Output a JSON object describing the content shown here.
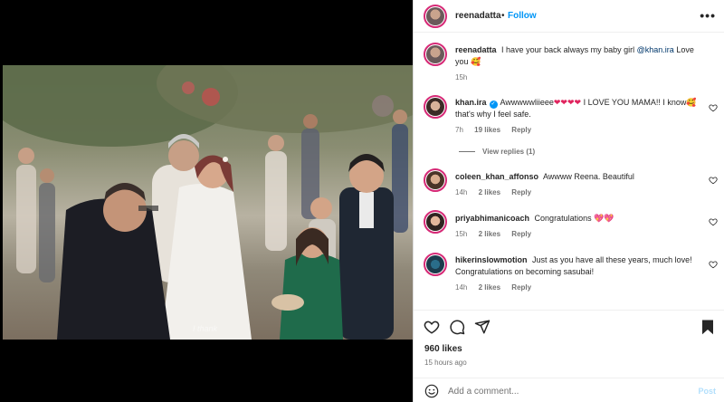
{
  "media": {
    "overlay_caption": "I thank"
  },
  "header": {
    "username": "reenadatta",
    "separator": "•",
    "follow_label": "Follow",
    "more_label": "•••"
  },
  "caption": {
    "username": "reenadatta",
    "text": "I have your back always my baby girl",
    "mention": "@khan.ira",
    "text_after": "Love you",
    "emoji": "🥰",
    "time": "15h"
  },
  "comments": [
    {
      "username": "khan.ira",
      "verified": true,
      "text_before": "Awwwwwliieee",
      "hearts": "❤❤❤❤",
      "text_after": "I LOVE YOU MAMA!! I know🥰 that's why I feel safe.",
      "time": "7h",
      "likes": "19 likes",
      "reply": "Reply",
      "view_replies": "View replies (1)"
    },
    {
      "username": "coleen_khan_affonso",
      "text": "Awwww Reena. Beautiful",
      "time": "14h",
      "likes": "2 likes",
      "reply": "Reply"
    },
    {
      "username": "priyabhimanicoach",
      "text": "Congratulations",
      "hearts": "💖💖",
      "time": "15h",
      "likes": "2 likes",
      "reply": "Reply"
    },
    {
      "username": "hikerinslowmotion",
      "text": "Just as you have all these years, much love! Congratulations on becoming sasubai!",
      "time": "14h",
      "likes": "2 likes",
      "reply": "Reply"
    }
  ],
  "actions": {
    "icons": [
      "heart-icon",
      "comment-icon",
      "share-icon",
      "bookmark-icon"
    ],
    "likes_count": "960 likes",
    "time_ago": "15 hours ago"
  },
  "add_comment": {
    "emoji_icon": "smiley-icon",
    "placeholder": "Add a comment...",
    "post_label": "Post"
  },
  "colors": {
    "accent": "#0095f6",
    "ring": "#d62976",
    "heart": "#e0245e"
  }
}
